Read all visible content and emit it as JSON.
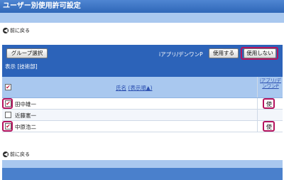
{
  "page": {
    "title": "ユーザー別使用許可設定"
  },
  "nav": {
    "back_label": "前に戻る",
    "back_icon": "arrow-left-circle-icon"
  },
  "toolbar": {
    "group_select_label": "グループ選択",
    "feature_label": "iアプリ/デンワンP",
    "enable_label": "使用する",
    "disable_label": "使用しない",
    "display_text": "表示 [技術部]"
  },
  "table": {
    "header": {
      "name_label": "氏名",
      "sort_label": "(表示順▲)",
      "feature_col": "iアプリ/デンワンP",
      "select_all_checked": true
    },
    "rows": [
      {
        "name": "田中雄一",
        "checked": true,
        "use_mark": "使"
      },
      {
        "name": "近藤憲一",
        "checked": false,
        "use_mark": ""
      },
      {
        "name": "中原浩二",
        "checked": true,
        "use_mark": "使"
      }
    ]
  },
  "colors": {
    "header_blue": "#2c63b9",
    "light_blue": "#a9c8ef",
    "highlight": "#b4145e"
  }
}
